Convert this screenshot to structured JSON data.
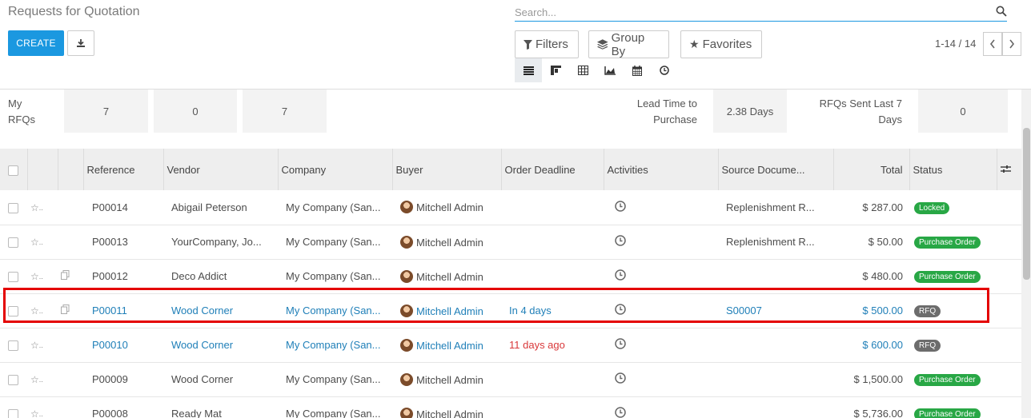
{
  "page": {
    "title": "Requests for Quotation",
    "create_label": "CREATE",
    "search_placeholder": "Search...",
    "filters_label": "Filters",
    "groupby_label": "Group By",
    "favorites_label": "Favorites",
    "pager_text": "1-14 / 14"
  },
  "views": [
    "list-view-icon",
    "kanban-view-icon",
    "pivot-view-icon",
    "graph-view-icon",
    "calendar-view-icon",
    "activity-view-icon"
  ],
  "dashboard": {
    "my_rfqs_label": "My RFQs",
    "box1": "7",
    "box2": "0",
    "box3": "7",
    "lead_time_label": "Lead Time to Purchase",
    "lead_time_value": "2.38 Days",
    "rfq_sent_label": "RFQs Sent Last 7 Days",
    "rfq_sent_value": "0"
  },
  "columns": {
    "reference": "Reference",
    "vendor": "Vendor",
    "company": "Company",
    "buyer": "Buyer",
    "deadline": "Order Deadline",
    "activities": "Activities",
    "source": "Source Docume...",
    "total": "Total",
    "status": "Status"
  },
  "rows": [
    {
      "ref": "P00014",
      "vendor": "Abigail Peterson",
      "company": "My Company (San...",
      "buyer": "Mitchell Admin",
      "deadline": "",
      "source": "Replenishment R...",
      "total": "$ 287.00",
      "status": "Locked"
    },
    {
      "ref": "P00013",
      "vendor": "YourCompany, Jo...",
      "company": "My Company (San...",
      "buyer": "Mitchell Admin",
      "deadline": "",
      "source": "Replenishment R...",
      "total": "$ 50.00",
      "status": "Purchase Order"
    },
    {
      "ref": "P00012",
      "vendor": "Deco Addict",
      "company": "My Company (San...",
      "buyer": "Mitchell Admin",
      "deadline": "",
      "source": "",
      "total": "$ 480.00",
      "status": "Purchase Order"
    },
    {
      "ref": "P00011",
      "vendor": "Wood Corner",
      "company": "My Company (San...",
      "buyer": "Mitchell Admin",
      "deadline": "In 4 days",
      "source": "S00007",
      "total": "$ 500.00",
      "status": "RFQ"
    },
    {
      "ref": "P00010",
      "vendor": "Wood Corner",
      "company": "My Company (San...",
      "buyer": "Mitchell Admin",
      "deadline": "11 days ago",
      "source": "",
      "total": "$ 600.00",
      "status": "RFQ"
    },
    {
      "ref": "P00009",
      "vendor": "Wood Corner",
      "company": "My Company (San...",
      "buyer": "Mitchell Admin",
      "deadline": "",
      "source": "",
      "total": "$ 1,500.00",
      "status": "Purchase Order"
    },
    {
      "ref": "P00008",
      "vendor": "Ready Mat",
      "company": "My Company (San...",
      "buyer": "Mitchell Admin",
      "deadline": "",
      "source": "",
      "total": "$ 5,736.00",
      "status": "Purchase Order"
    }
  ]
}
